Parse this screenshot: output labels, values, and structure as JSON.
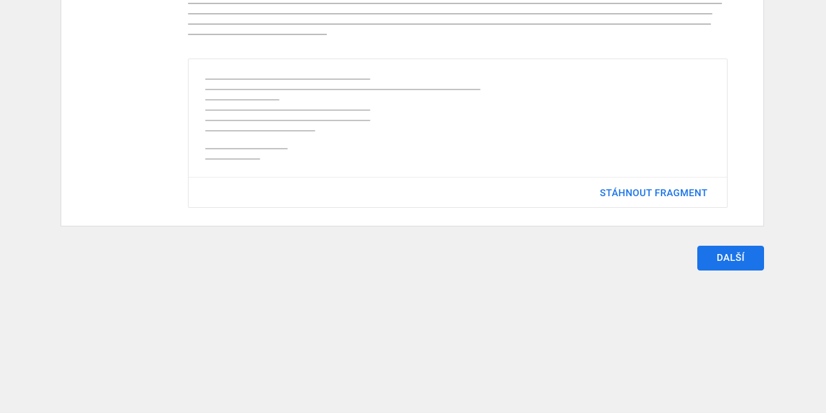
{
  "codebox": {
    "download_label": "STÁHNOUT FRAGMENT"
  },
  "actions": {
    "next_label": "DALŠÍ"
  },
  "placeholders": {
    "paragraph_widths": [
      100,
      98.2,
      98,
      26
    ],
    "code_widths": [
      60,
      100,
      27,
      60,
      60,
      40
    ],
    "code_widths2": [
      30,
      20
    ]
  },
  "colors": {
    "accent": "#1a73e8",
    "page_bg": "#f0f0f0",
    "card_border": "#dadce0"
  }
}
